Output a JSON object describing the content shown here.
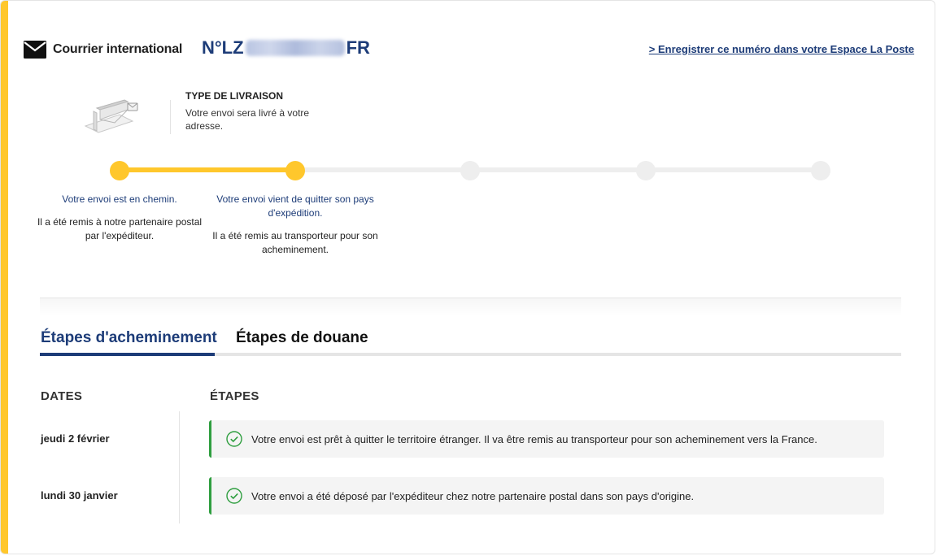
{
  "header": {
    "service_name": "Courrier international",
    "tracking_prefix": "N°LZ",
    "tracking_suffix": "FR",
    "register_link": "> Enregistrer ce numéro dans votre Espace La Poste"
  },
  "delivery_type": {
    "title": "TYPE DE LIVRAISON",
    "description": "Votre envoi sera livré à votre adresse."
  },
  "timeline": {
    "steps": [
      {
        "title": "Votre envoi est en chemin.",
        "subtitle": "Il a été remis à notre partenaire postal par l'expéditeur.",
        "done": true
      },
      {
        "title": "Votre envoi vient de quitter son pays d'expédition.",
        "subtitle": "Il a été remis au transporteur pour son acheminement.",
        "done": true
      },
      {
        "title": "",
        "subtitle": "",
        "done": false
      },
      {
        "title": "",
        "subtitle": "",
        "done": false
      },
      {
        "title": "",
        "subtitle": "",
        "done": false
      }
    ]
  },
  "tabs": [
    {
      "label": "Étapes d'acheminement",
      "active": true
    },
    {
      "label": "Étapes de douane",
      "active": false
    }
  ],
  "history": {
    "dates_header": "DATES",
    "steps_header": "ÉTAPES",
    "rows": [
      {
        "date": "jeudi 2 février",
        "event": "Votre envoi est prêt à quitter le territoire étranger. Il va être remis au transporteur pour son acheminement vers la France."
      },
      {
        "date": "lundi 30 janvier",
        "event": "Votre envoi a été déposé par l'expéditeur chez notre partenaire postal dans son pays d'origine."
      }
    ]
  },
  "colors": {
    "accent_yellow": "#ffc72c",
    "brand_blue": "#1d3c78",
    "success_green": "#2e9e3f"
  }
}
